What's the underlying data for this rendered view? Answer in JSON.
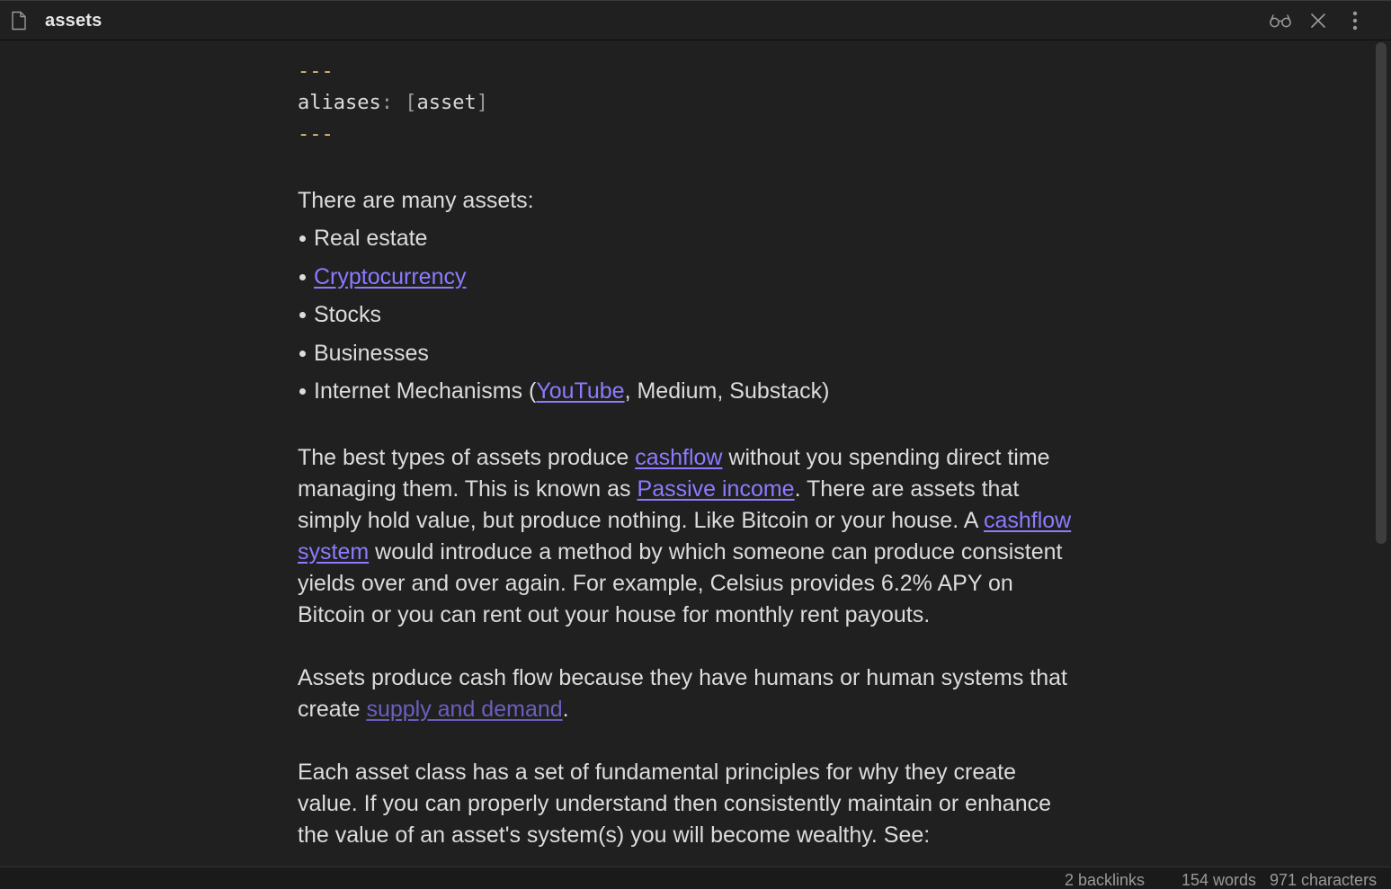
{
  "titlebar": {
    "title": "assets",
    "file_icon": "file-icon",
    "reading_view_icon": "glasses-icon",
    "close_icon": "close-icon",
    "more_icon": "more-vertical-icon"
  },
  "frontmatter": {
    "dashes_open": "---",
    "key": "aliases",
    "colon": ":",
    "bracket_open": "[",
    "value": "asset",
    "bracket_close": "]",
    "dashes_close": "---"
  },
  "intro": "There are many assets:",
  "list": {
    "item1": "Real estate",
    "item2_link": "Cryptocurrency",
    "item3": "Stocks",
    "item4": "Businesses",
    "item5_pre": "Internet Mechanisms (",
    "item5_link": "YouTube",
    "item5_post": ", Medium, Substack)"
  },
  "para1": {
    "t1": "The best types of assets produce ",
    "link1": "cashflow",
    "t2": " without you spending direct time managing them. This is known as ",
    "link2": "Passive income",
    "t3": ". There are assets that simply hold value, but produce nothing. Like Bitcoin or your house. A ",
    "link3": "cashflow system",
    "t4": " would introduce a method by which someone can produce consistent yields over and over again. For example, Celsius provides 6.2% APY on Bitcoin or you can rent out your house for monthly rent payouts."
  },
  "para2": {
    "t1": "Assets produce cash flow because they have humans or human systems that create ",
    "link1": "supply and demand",
    "t2": "."
  },
  "para3": {
    "t1": "Each asset class has a set of fundamental principles for why they create value. If you can properly understand then consistently maintain or enhance the value of an asset's system(s) you will become wealthy. See:"
  },
  "status": {
    "backlinks": "2 backlinks",
    "words": "154 words",
    "characters": "971 characters"
  },
  "colors": {
    "background": "#202020",
    "text": "#dcdcdc",
    "link": "#8c7bff",
    "unresolved_link": "#6b5fbf",
    "frontmatter_dashes": "#e5c07b"
  }
}
